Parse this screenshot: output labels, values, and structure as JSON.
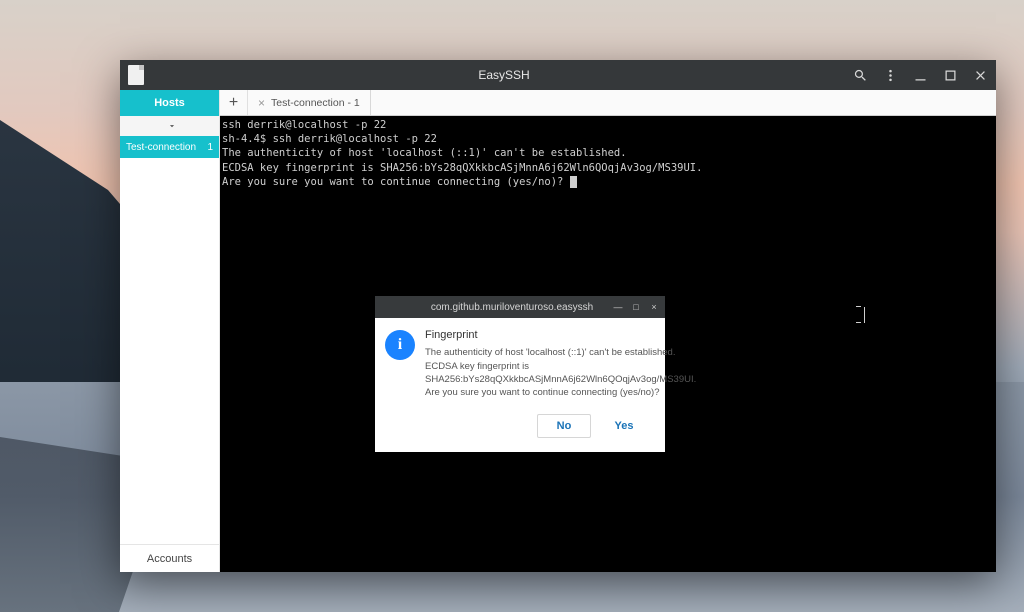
{
  "window": {
    "title": "EasySSH"
  },
  "sidebar": {
    "header": "Hosts",
    "items": [
      {
        "label": "Test-connection",
        "count": "1"
      }
    ],
    "footer": "Accounts"
  },
  "tabs": [
    {
      "label": "Test-connection - 1"
    }
  ],
  "terminal": {
    "lines": [
      "ssh derrik@localhost -p 22",
      "sh-4.4$ ssh derrik@localhost -p 22",
      "The authenticity of host 'localhost (::1)' can't be established.",
      "ECDSA key fingerprint is SHA256:bYs28qQXkkbcASjMnnA6j62Wln6QOqjAv3og/MS39UI.",
      "Are you sure you want to continue connecting (yes/no)? "
    ]
  },
  "dialog": {
    "window_title": "com.github.muriloventuroso.easyssh",
    "heading": "Fingerprint",
    "text_lines": [
      "The authenticity of host 'localhost (::1)' can't be established.",
      "ECDSA key fingerprint is",
      "SHA256:bYs28qQXkkbcASjMnnA6j62Wln6QOqjAv3og/MS39UI.",
      "Are you sure you want to continue connecting (yes/no)?"
    ],
    "buttons": {
      "no": "No",
      "yes": "Yes"
    }
  }
}
